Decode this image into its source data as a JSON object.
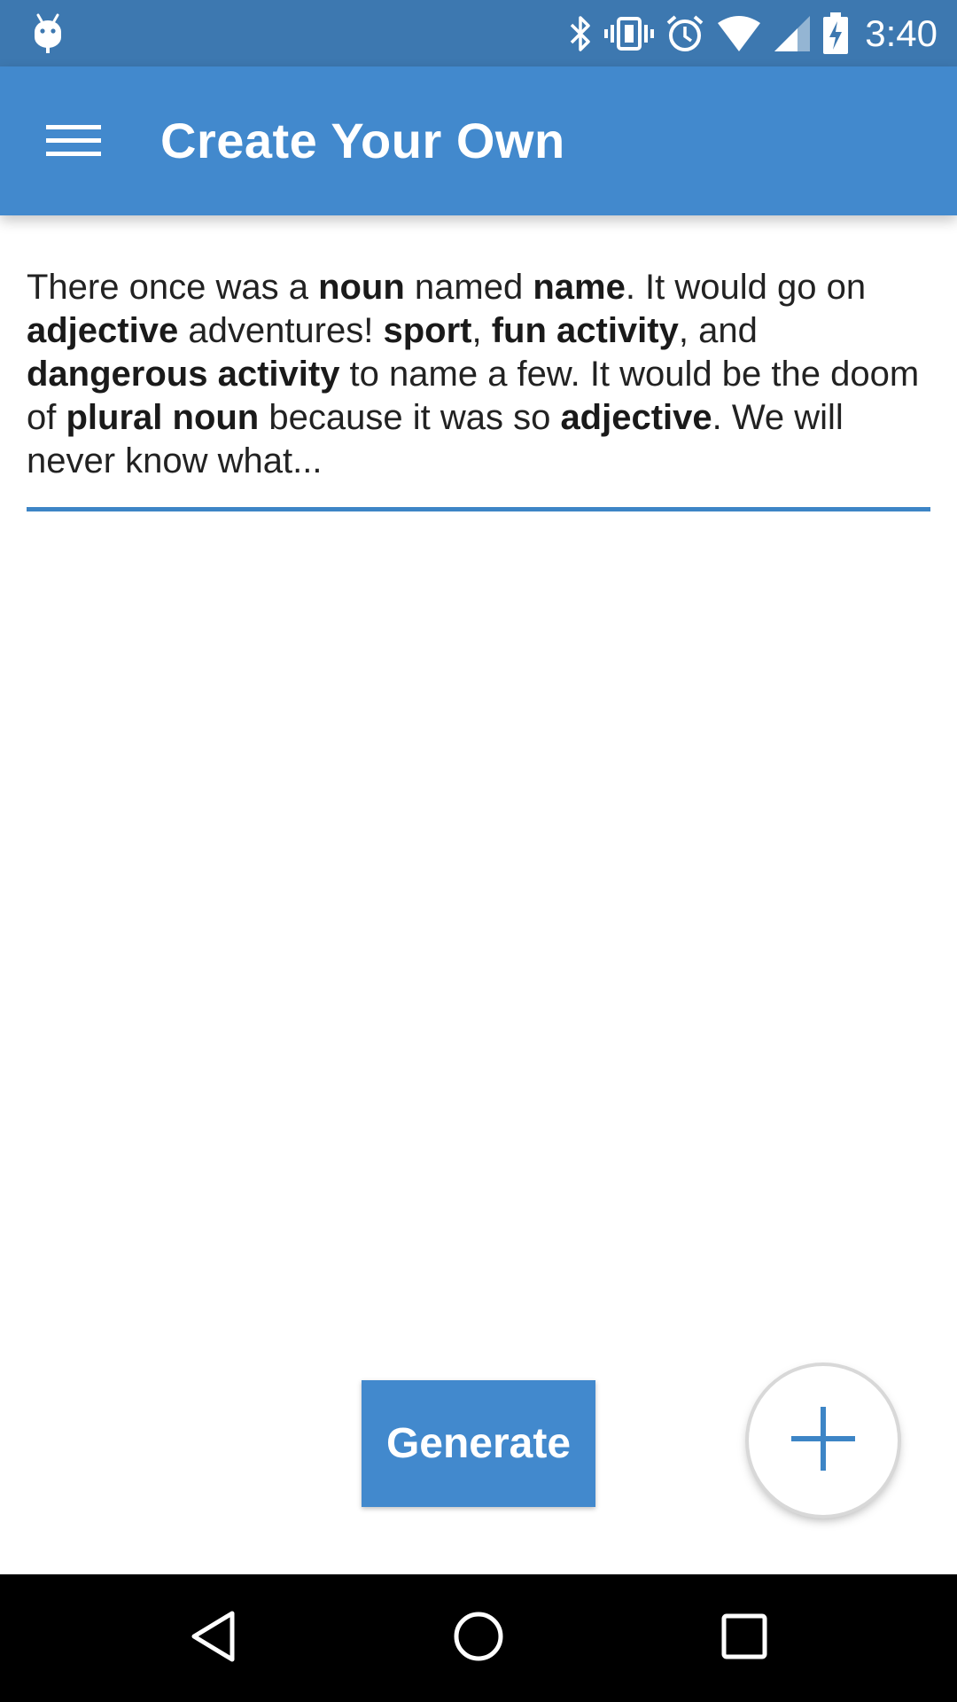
{
  "status_bar": {
    "time": "3:40",
    "icons": [
      "android-debug-icon",
      "bluetooth-icon",
      "vibrate-icon",
      "alarm-icon",
      "wifi-icon",
      "signal-icon",
      "battery-charging-icon"
    ]
  },
  "app_bar": {
    "title": "Create Your Own",
    "menu_icon": "hamburger-menu-icon"
  },
  "story": {
    "segments": [
      {
        "text": "There once was a ",
        "bold": false
      },
      {
        "text": "noun",
        "bold": true
      },
      {
        "text": " named ",
        "bold": false
      },
      {
        "text": "name",
        "bold": true
      },
      {
        "text": ". It would go on ",
        "bold": false
      },
      {
        "text": "adjective",
        "bold": true
      },
      {
        "text": " adventures! ",
        "bold": false
      },
      {
        "text": "sport",
        "bold": true
      },
      {
        "text": ", ",
        "bold": false
      },
      {
        "text": "fun activity",
        "bold": true
      },
      {
        "text": ", and ",
        "bold": false
      },
      {
        "text": "dangerous activity",
        "bold": true
      },
      {
        "text": " to name a few. It would be the doom of ",
        "bold": false
      },
      {
        "text": "plural noun",
        "bold": true
      },
      {
        "text": " because it was so ",
        "bold": false
      },
      {
        "text": "adjective",
        "bold": true
      },
      {
        "text": ". We will never know what...",
        "bold": false
      }
    ]
  },
  "actions": {
    "generate_label": "Generate",
    "fab_icon": "plus-icon"
  },
  "nav_bar": {
    "back_icon": "back-triangle-icon",
    "home_icon": "home-circle-icon",
    "recents_icon": "recents-square-icon"
  },
  "colors": {
    "status_bar": "#3d78b0",
    "app_bar": "#4289cd",
    "accent": "#3d85c6"
  }
}
